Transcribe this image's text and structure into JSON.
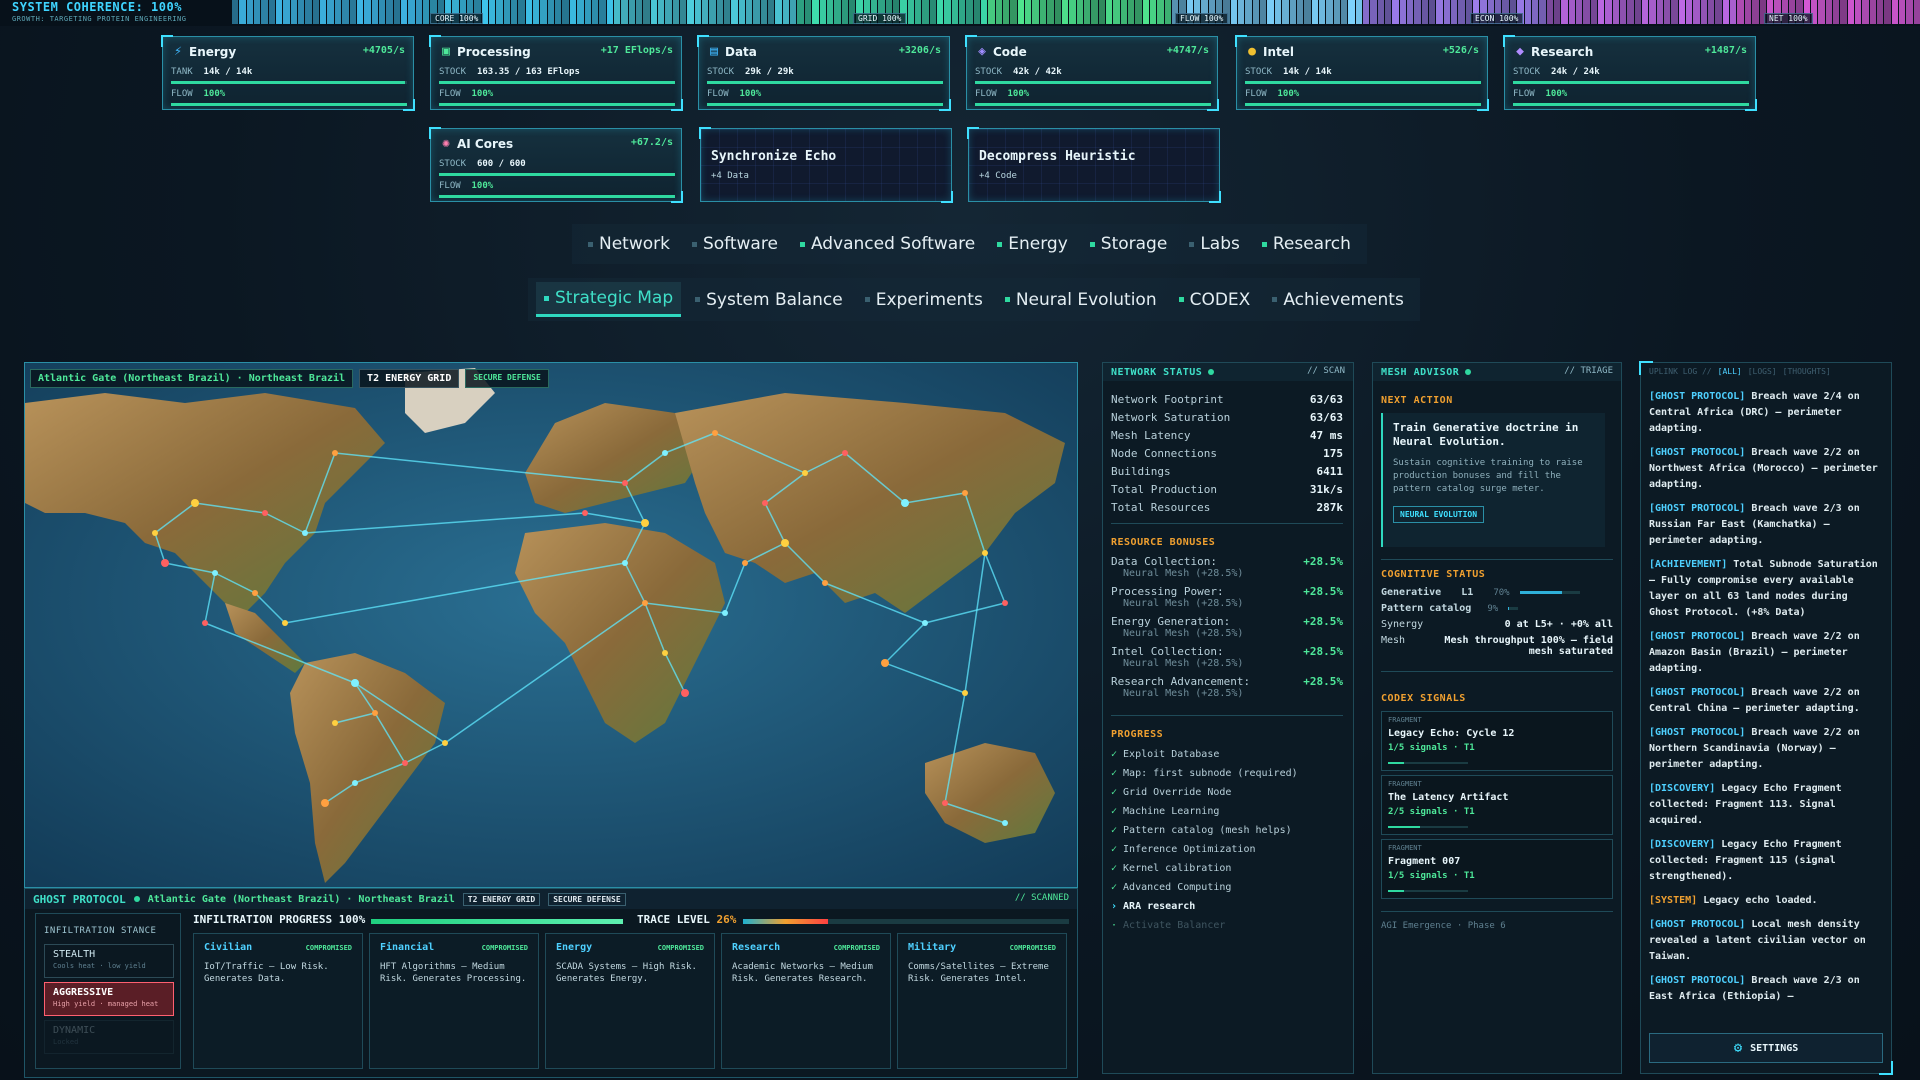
{
  "topbar": {
    "title": "SYSTEM COHERENCE: 100%",
    "subtitle": "GROWTH: TARGETING PROTEIN ENGINEERING",
    "segments": [
      "CORE 100%",
      "GRID 100%",
      "FLOW 100%",
      "ECON 100%",
      "NET 100%"
    ]
  },
  "resources": [
    {
      "name": "Energy",
      "icon": "lightning-icon",
      "rate": "+4705/s",
      "stock_label": "TANK",
      "stock": "14k / 14k",
      "flow": "100%",
      "fill": 0.99
    },
    {
      "name": "Processing",
      "icon": "cpu-icon",
      "rate": "+17 EFlops/s",
      "stock_label": "STOCK",
      "stock": "163.35 / 163 EFlops",
      "flow": "100%",
      "fill": 1.0
    },
    {
      "name": "Data",
      "icon": "database-icon",
      "rate": "+3206/s",
      "stock_label": "STOCK",
      "stock": "29k / 29k",
      "flow": "100%",
      "fill": 1.0
    },
    {
      "name": "Code",
      "icon": "code-icon",
      "rate": "+4747/s",
      "stock_label": "STOCK",
      "stock": "42k / 42k",
      "flow": "100%",
      "fill": 1.0
    },
    {
      "name": "Intel",
      "icon": "coin-icon",
      "rate": "+526/s",
      "stock_label": "STOCK",
      "stock": "14k / 14k",
      "flow": "100%",
      "fill": 1.0
    },
    {
      "name": "Research",
      "icon": "layers-icon",
      "rate": "+1487/s",
      "stock_label": "STOCK",
      "stock": "24k / 24k",
      "flow": "100%",
      "fill": 1.0
    },
    {
      "name": "AI Cores",
      "icon": "brain-icon",
      "rate": "+67.2/s",
      "stock_label": "STOCK",
      "stock": "600 / 600",
      "flow": "100%",
      "fill": 1.0
    }
  ],
  "actions": [
    {
      "title": "Synchronize Echo",
      "sub": "+4 Data"
    },
    {
      "title": "Decompress Heuristic",
      "sub": "+4 Code"
    }
  ],
  "tabs_row1": [
    "Network",
    "Software",
    "Advanced Software",
    "Energy",
    "Storage",
    "Labs",
    "Research"
  ],
  "tabs_row2": [
    "Strategic Map",
    "System Balance",
    "Experiments",
    "Neural Evolution",
    "CODEX",
    "Achievements"
  ],
  "map": {
    "location": "Atlantic Gate (Northeast Brazil) · Northeast Brazil",
    "grid_tag": "T2 ENERGY GRID",
    "defense_tag": "SECURE DEFENSE"
  },
  "ghost": {
    "title": "GHOST PROTOCOL",
    "location": "Atlantic Gate (Northeast Brazil) · Northeast Brazil",
    "grid_tag": "T2 ENERGY GRID",
    "defense_tag": "SECURE DEFENSE",
    "scanned": "// SCANNED",
    "stance_title": "INFILTRATION STANCE",
    "stances": [
      {
        "name": "STEALTH",
        "desc": "Cools heat · low yield"
      },
      {
        "name": "AGGRESSIVE",
        "desc": "High yield · managed heat"
      },
      {
        "name": "DYNAMIC",
        "desc": "Locked"
      }
    ],
    "progress_label": "INFILTRATION PROGRESS",
    "progress_value": "100%",
    "progress": 1.0,
    "trace_label": "TRACE LEVEL",
    "trace_value": "26%",
    "trace": 0.26,
    "categories": [
      {
        "name": "Civilian",
        "state": "COMPROMISED",
        "desc": "IoT/Traffic — Low Risk. Generates Data."
      },
      {
        "name": "Financial",
        "state": "COMPROMISED",
        "desc": "HFT Algorithms — Medium Risk. Generates Processing."
      },
      {
        "name": "Energy",
        "state": "COMPROMISED",
        "desc": "SCADA Systems — High Risk. Generates Energy."
      },
      {
        "name": "Research",
        "state": "COMPROMISED",
        "desc": "Academic Networks — Medium Risk. Generates Research."
      },
      {
        "name": "Military",
        "state": "COMPROMISED",
        "desc": "Comms/Satellites — Extreme Risk. Generates Intel."
      }
    ]
  },
  "network_status": {
    "title": "NETWORK STATUS",
    "right": "// SCAN",
    "stats": [
      {
        "label": "Network Footprint",
        "value": "63/63"
      },
      {
        "label": "Network Saturation",
        "value": "63/63"
      },
      {
        "label": "Mesh Latency",
        "value": "47 ms"
      },
      {
        "label": "Node Connections",
        "value": "175"
      },
      {
        "label": "Buildings",
        "value": "6411"
      },
      {
        "label": "Total Production",
        "value": "31k/s"
      },
      {
        "label": "Total Resources",
        "value": "287k"
      }
    ],
    "bonus_title": "RESOURCE BONUSES",
    "bonuses": [
      {
        "label": "Data Collection:",
        "value": "+28.5%",
        "sub": "Neural Mesh (+28.5%)"
      },
      {
        "label": "Processing Power:",
        "value": "+28.5%",
        "sub": "Neural Mesh (+28.5%)"
      },
      {
        "label": "Energy Generation:",
        "value": "+28.5%",
        "sub": "Neural Mesh (+28.5%)"
      },
      {
        "label": "Intel Collection:",
        "value": "+28.5%",
        "sub": "Neural Mesh (+28.5%)"
      },
      {
        "label": "Research Advancement:",
        "value": "+28.5%",
        "sub": "Neural Mesh (+28.5%)"
      }
    ],
    "progress_title": "PROGRESS",
    "progress": [
      {
        "label": "Exploit Database",
        "mark": "✓",
        "kind": "done"
      },
      {
        "label": "Map: first subnode (required)",
        "mark": "✓",
        "kind": "done"
      },
      {
        "label": "Grid Override Node",
        "mark": "✓",
        "kind": "done"
      },
      {
        "label": "Machine Learning",
        "mark": "✓",
        "kind": "done"
      },
      {
        "label": "Pattern catalog (mesh helps)",
        "mark": "✓",
        "kind": "done"
      },
      {
        "label": "Inference Optimization",
        "mark": "✓",
        "kind": "done"
      },
      {
        "label": "Kernel calibration",
        "mark": "✓",
        "kind": "done"
      },
      {
        "label": "Advanced Computing",
        "mark": "✓",
        "kind": "done"
      },
      {
        "label": "ARA research",
        "mark": "›",
        "kind": "cur"
      },
      {
        "label": "Activate Balancer",
        "mark": "·",
        "kind": "dim"
      }
    ]
  },
  "mesh_advisor": {
    "title": "MESH ADVISOR",
    "right": "// TRIAGE",
    "next_title": "NEXT ACTION",
    "next_head": "Train Generative doctrine in Neural Evolution.",
    "next_desc": "Sustain cognitive training to raise production bonuses and fill the pattern catalog surge meter.",
    "next_btn": "NEURAL EVOLUTION",
    "cog_title": "COGNITIVE STATUS",
    "generative_label": "Generative",
    "generative_level": "L1",
    "generative_pct": "70%",
    "generative_fill": 0.7,
    "pattern_label": "Pattern catalog",
    "pattern_pct": "9%",
    "pattern_fill": 0.09,
    "synergy_label": "Synergy",
    "synergy_value": "0 at L5+ · +0% all",
    "mesh_label": "Mesh",
    "mesh_value": "Mesh throughput 100% — field mesh saturated",
    "codex_title": "CODEX SIGNALS",
    "fragments": [
      {
        "kind": "FRAGMENT",
        "name": "Legacy Echo: Cycle 12",
        "signals": "1/5 signals · T1",
        "fill": 0.2
      },
      {
        "kind": "FRAGMENT",
        "name": "The Latency Artifact",
        "signals": "2/5 signals · T1",
        "fill": 0.4
      },
      {
        "kind": "FRAGMENT",
        "name": "Fragment 007",
        "signals": "1/5 signals · T1",
        "fill": 0.2
      }
    ],
    "footer": "AGI Emergence · Phase 6"
  },
  "uplink": {
    "title": "UPLINK LOG //",
    "tabs": [
      "[ALL]",
      "[LOGS]",
      "[THOUGHTS]"
    ],
    "entries": [
      {
        "tag": "[GHOST PROTOCOL]",
        "text": " Breach wave 2/4 on Central Africa (DRC) — perimeter adapting."
      },
      {
        "tag": "[GHOST PROTOCOL]",
        "text": " Breach wave 2/2 on Northwest Africa (Morocco) — perimeter adapting."
      },
      {
        "tag": "[GHOST PROTOCOL]",
        "text": " Breach wave 2/3 on Russian Far East (Kamchatka) — perimeter adapting."
      },
      {
        "tag": "[ACHIEVEMENT]",
        "text": " Total Subnode Saturation — Fully compromise every available layer on all 63 land nodes during Ghost Protocol. (+8% Data)"
      },
      {
        "tag": "[GHOST PROTOCOL]",
        "text": " Breach wave 2/2 on Amazon Basin (Brazil) — perimeter adapting."
      },
      {
        "tag": "[GHOST PROTOCOL]",
        "text": " Breach wave 2/2 on Central China — perimeter adapting."
      },
      {
        "tag": "[GHOST PROTOCOL]",
        "text": " Breach wave 2/2 on Northern Scandinavia (Norway) — perimeter adapting."
      },
      {
        "tag": "[DISCOVERY]",
        "text": " Legacy Echo Fragment collected: Fragment 113. Signal acquired."
      },
      {
        "tag": "[DISCOVERY]",
        "text": " Legacy Echo Fragment collected: Fragment 115 (signal strengthened)."
      },
      {
        "tag": "[SYSTEM]",
        "text": " Legacy echo loaded."
      },
      {
        "tag": "[GHOST PROTOCOL]",
        "text": " Local mesh density revealed a latent civilian vector on Taiwan."
      },
      {
        "tag": "[GHOST PROTOCOL]",
        "text": " Breach wave 2/3 on East Africa (Ethiopia) —"
      }
    ],
    "settings": "SETTINGS"
  },
  "colors": {
    "accent": "#3fe0c8",
    "good": "#4ee89a",
    "warn": "#f0a030",
    "danger": "#ff6070"
  }
}
